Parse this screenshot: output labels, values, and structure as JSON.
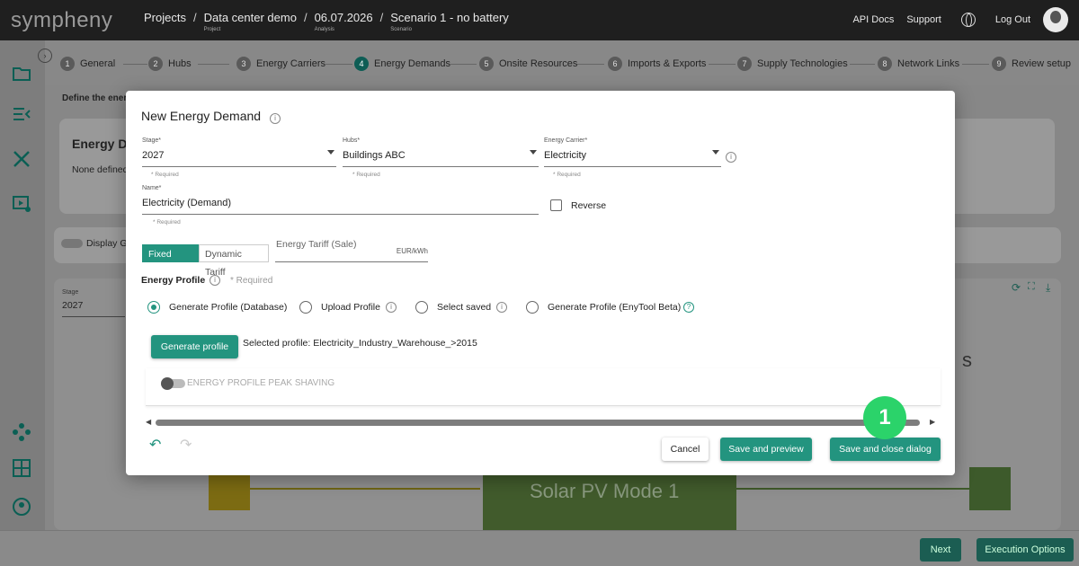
{
  "app": {
    "logo": "sympheny"
  },
  "breadcrumb": [
    {
      "label": "Projects",
      "sub": ""
    },
    {
      "label": "Data center demo",
      "sub": "Project"
    },
    {
      "label": "06.07.2026",
      "sub": "Analysis"
    },
    {
      "label": "Scenario 1 - no battery",
      "sub": "Scenario"
    }
  ],
  "topnav": {
    "api_docs": "API Docs",
    "support": "Support",
    "logout": "Log Out"
  },
  "steps": [
    {
      "num": "1",
      "label": "General"
    },
    {
      "num": "2",
      "label": "Hubs"
    },
    {
      "num": "3",
      "label": "Energy Carriers"
    },
    {
      "num": "4",
      "label": "Energy Demands"
    },
    {
      "num": "5",
      "label": "Onsite Resources"
    },
    {
      "num": "6",
      "label": "Imports & Exports"
    },
    {
      "num": "7",
      "label": "Supply Technologies"
    },
    {
      "num": "8",
      "label": "Network Links"
    },
    {
      "num": "9",
      "label": "Review setup"
    }
  ],
  "background": {
    "define_text": "Define the ener",
    "card_title": "Energy De",
    "card_text": "None defined",
    "display_label": "Display G",
    "stage_label": "Stage",
    "stage_value": "2027",
    "canvas_label": "Solar PV Mode 1",
    "partial_text": "s"
  },
  "modal": {
    "title": "New Energy Demand",
    "stage": {
      "label": "Stage*",
      "value": "2027",
      "required": "* Required"
    },
    "hubs": {
      "label": "Hubs*",
      "value": "Buildings ABC",
      "required": "* Required"
    },
    "carrier": {
      "label": "Energy Carrier*",
      "value": "Electricity",
      "required": "* Required"
    },
    "name": {
      "label": "Name*",
      "value": "Electricity (Demand)",
      "required": "* Required"
    },
    "reverse_label": "Reverse",
    "tariff_tabs": [
      "Fixed Tariff",
      "Dynamic Tariff"
    ],
    "tariff_field": {
      "placeholder": "Energy Tariff (Sale)",
      "unit": "EUR/kWh"
    },
    "profile_label": "Energy Profile",
    "profile_required": "* Required",
    "profile_options": [
      "Generate Profile (Database)",
      "Upload Profile",
      "Select saved",
      "Generate Profile (EnyTool Beta)"
    ],
    "generate_button": "Generate profile",
    "selected_profile": "Selected profile: Electricity_Industry_Warehouse_>2015",
    "peak_shaving_label": "ENERGY PROFILE PEAK SHAVING",
    "cancel": "Cancel",
    "save_preview": "Save and preview",
    "save_close": "Save and close dialog"
  },
  "marker": "1",
  "footer": {
    "next": "Next",
    "execution_options": "Execution Options"
  }
}
